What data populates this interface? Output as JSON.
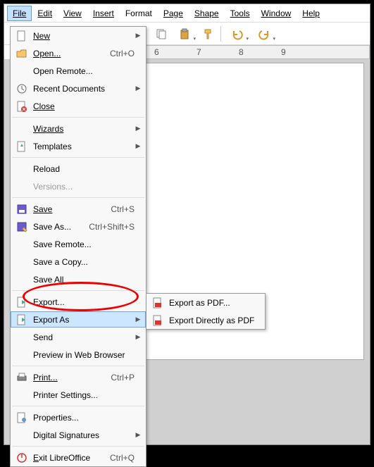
{
  "menubar": {
    "file": "File",
    "edit": "Edit",
    "view": "View",
    "insert": "Insert",
    "format": "Format",
    "page": "Page",
    "shape": "Shape",
    "tools": "Tools",
    "window": "Window",
    "help": "Help"
  },
  "ruler": {
    "t6": "6",
    "t7": "7",
    "t8": "8",
    "t9": "9"
  },
  "menu": {
    "new": "New",
    "open": "Open...",
    "open_sc": "Ctrl+O",
    "open_remote": "Open Remote...",
    "recent": "Recent Documents",
    "close": "Close",
    "wizards": "Wizards",
    "templates": "Templates",
    "reload": "Reload",
    "versions": "Versions...",
    "save": "Save",
    "save_sc": "Ctrl+S",
    "save_as": "Save As...",
    "save_as_sc": "Ctrl+Shift+S",
    "save_remote": "Save Remote...",
    "save_copy": "Save a Copy...",
    "save_all": "Save All",
    "export": "Export...",
    "export_as": "Export As",
    "send": "Send",
    "preview": "Preview in Web Browser",
    "print": "Print...",
    "print_sc": "Ctrl+P",
    "printer_settings": "Printer Settings...",
    "properties": "Properties...",
    "dig_sig": "Digital Signatures",
    "exit": "Exit LibreOffice",
    "exit_sc": "Ctrl+Q"
  },
  "submenu": {
    "export_pdf": "Export as PDF...",
    "export_direct": "Export Directly as PDF"
  }
}
